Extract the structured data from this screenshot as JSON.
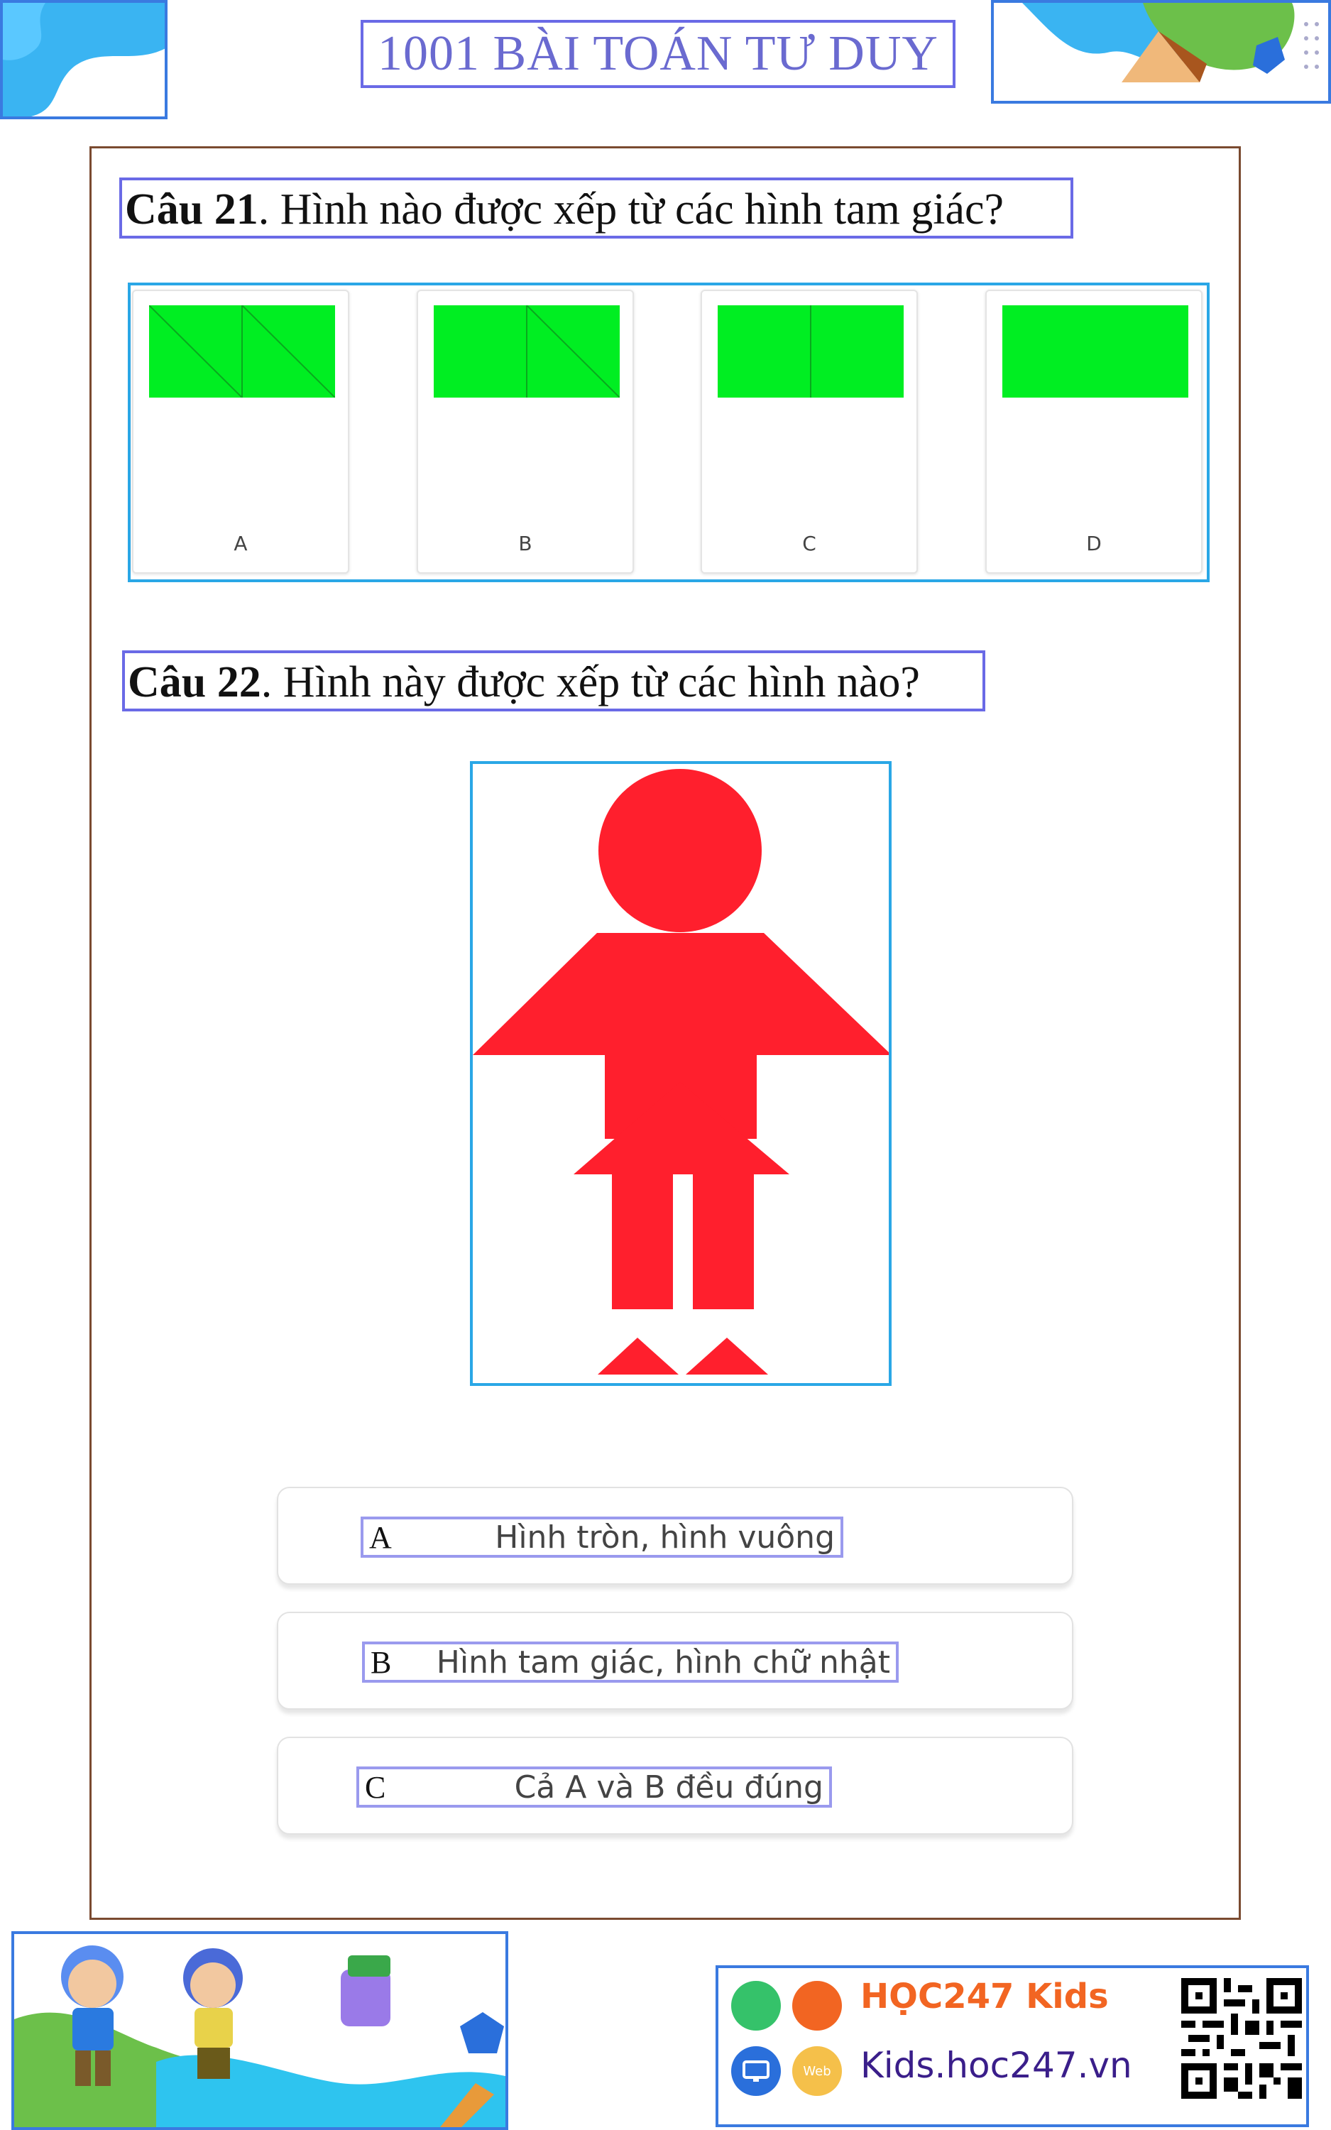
{
  "header": {
    "title": "1001 BÀI TOÁN TƯ DUY"
  },
  "question21": {
    "number": "Câu 21",
    "text": ". Hình nào được xếp từ các hình tam giác?",
    "options": [
      "A",
      "B",
      "C",
      "D"
    ],
    "shape_color": "#00ee22"
  },
  "question22": {
    "number": "Câu 22",
    "text": ". Hình này được xếp từ các hình nào?",
    "figure_color": "#ff1f2d",
    "answers": [
      {
        "letter": "A",
        "text": "Hình tròn, hình vuông"
      },
      {
        "letter": "B",
        "text": "Hình tam giác, hình chữ nhật"
      },
      {
        "letter": "C",
        "text": "Cả A và B đều đúng"
      }
    ]
  },
  "footer": {
    "brand": "HỌC247 Kids",
    "site": "Kids.hoc247.vn",
    "web_badge": "Web"
  },
  "colors": {
    "frame": "#7a4a30",
    "annotation": "#6a6ae6",
    "brand_orange": "#f26522",
    "blue_accent": "#2a6fdb"
  }
}
